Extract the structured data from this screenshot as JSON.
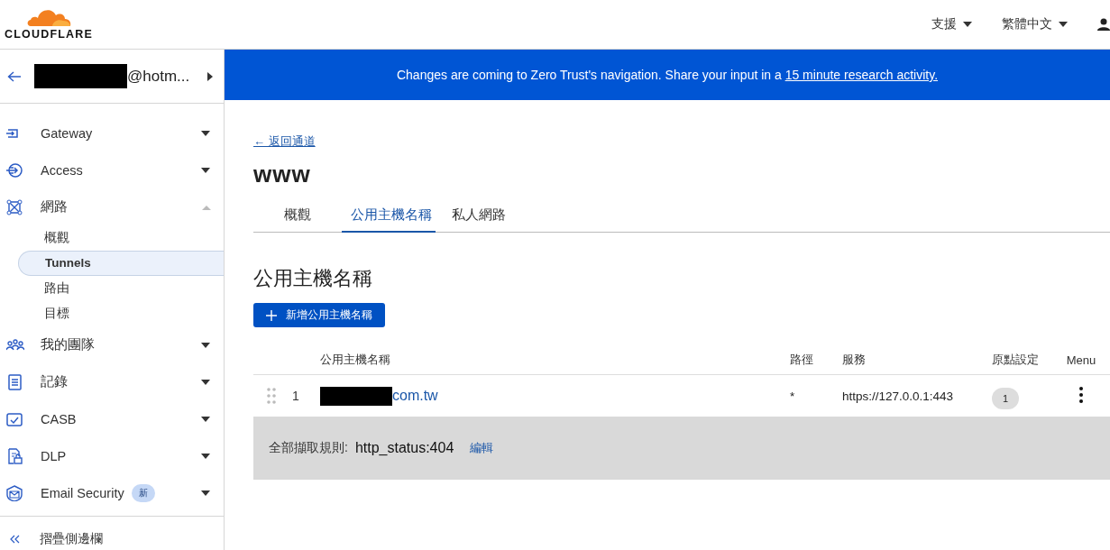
{
  "header": {
    "logo": "CLOUDFLARE",
    "menus": [
      {
        "label": "支援"
      },
      {
        "label": "繁體中文"
      }
    ]
  },
  "account": {
    "email": "@hotm..."
  },
  "sidebar": {
    "items": [
      {
        "label": "Gateway",
        "expanded": false
      },
      {
        "label": "Access",
        "expanded": false
      },
      {
        "label": "網路",
        "expanded": true,
        "children": [
          {
            "label": "概觀",
            "selected": false
          },
          {
            "label": "Tunnels",
            "selected": true
          },
          {
            "label": "路由",
            "selected": false
          },
          {
            "label": "目標",
            "selected": false
          }
        ]
      },
      {
        "label": "我的團隊",
        "expanded": false
      },
      {
        "label": "記錄",
        "expanded": false
      },
      {
        "label": "CASB",
        "expanded": false
      },
      {
        "label": "DLP",
        "expanded": false
      },
      {
        "label": "Email Security",
        "expanded": false,
        "badge": "新"
      }
    ],
    "collapse": "摺疊側邊欄"
  },
  "banner": {
    "text": "Changes are coming to Zero Trust's navigation. Share your input in a ",
    "link": "15 minute research activity."
  },
  "back_link": "← 返回通道",
  "title": "www",
  "tabs": [
    {
      "label": "概觀",
      "selected": false
    },
    {
      "label": "公用主機名稱",
      "selected": true
    },
    {
      "label": "私人網路",
      "selected": false
    }
  ],
  "section_title": "公用主機名稱",
  "add_button": "新增公用主機名稱",
  "table": {
    "columns": [
      "公用主機名稱",
      "路徑",
      "服務",
      "原點設定",
      "Menu"
    ],
    "rows": [
      {
        "index": "1",
        "hostname": "com.tw",
        "path": "*",
        "service": "https://127.0.0.1:443",
        "origin_settings": "1"
      }
    ]
  },
  "catch_all": {
    "label": "全部擷取規則:",
    "value": "http_status:404",
    "edit": "編輯"
  }
}
